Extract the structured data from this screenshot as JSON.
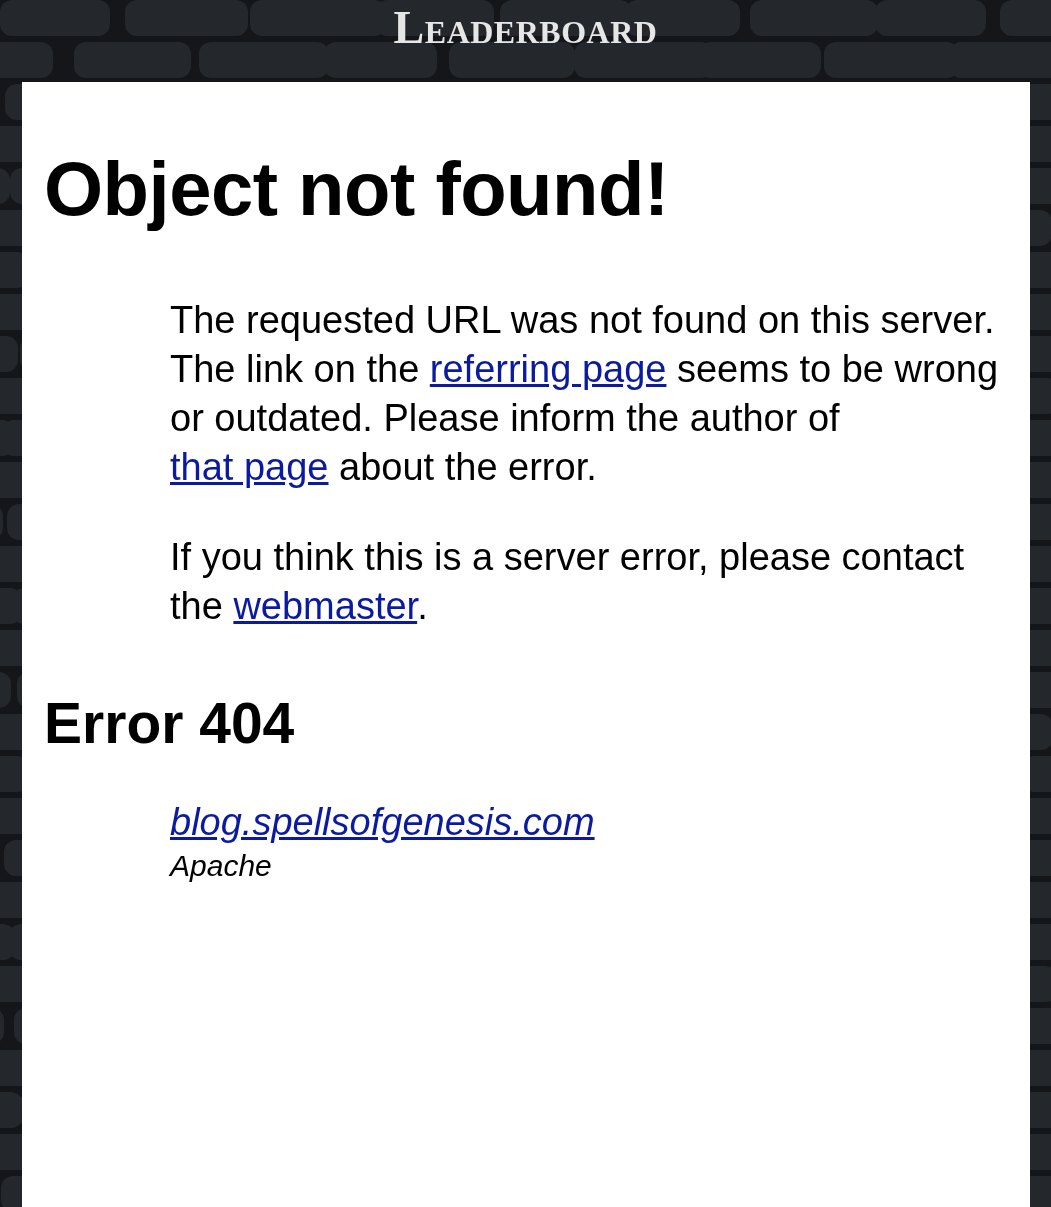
{
  "header": {
    "title": "Leaderboard"
  },
  "heading": "Object not found!",
  "paragraphs": [
    [
      {
        "kind": "text",
        "text": "The requested URL was not found on this server. The link on the "
      },
      {
        "kind": "link",
        "text": "referring page"
      },
      {
        "kind": "text",
        "text": " seems to be wrong or outdated. Please inform the author of "
      },
      {
        "kind": "link",
        "text": "that page"
      },
      {
        "kind": "text",
        "text": " about the error."
      }
    ],
    [
      {
        "kind": "text",
        "text": "If you think this is a server error, please contact the "
      },
      {
        "kind": "link",
        "text": "webmaster"
      },
      {
        "kind": "text",
        "text": "."
      }
    ]
  ],
  "error_heading": "Error 404",
  "address": {
    "host": "blog.spellsofgenesis.com",
    "server": "Apache"
  }
}
